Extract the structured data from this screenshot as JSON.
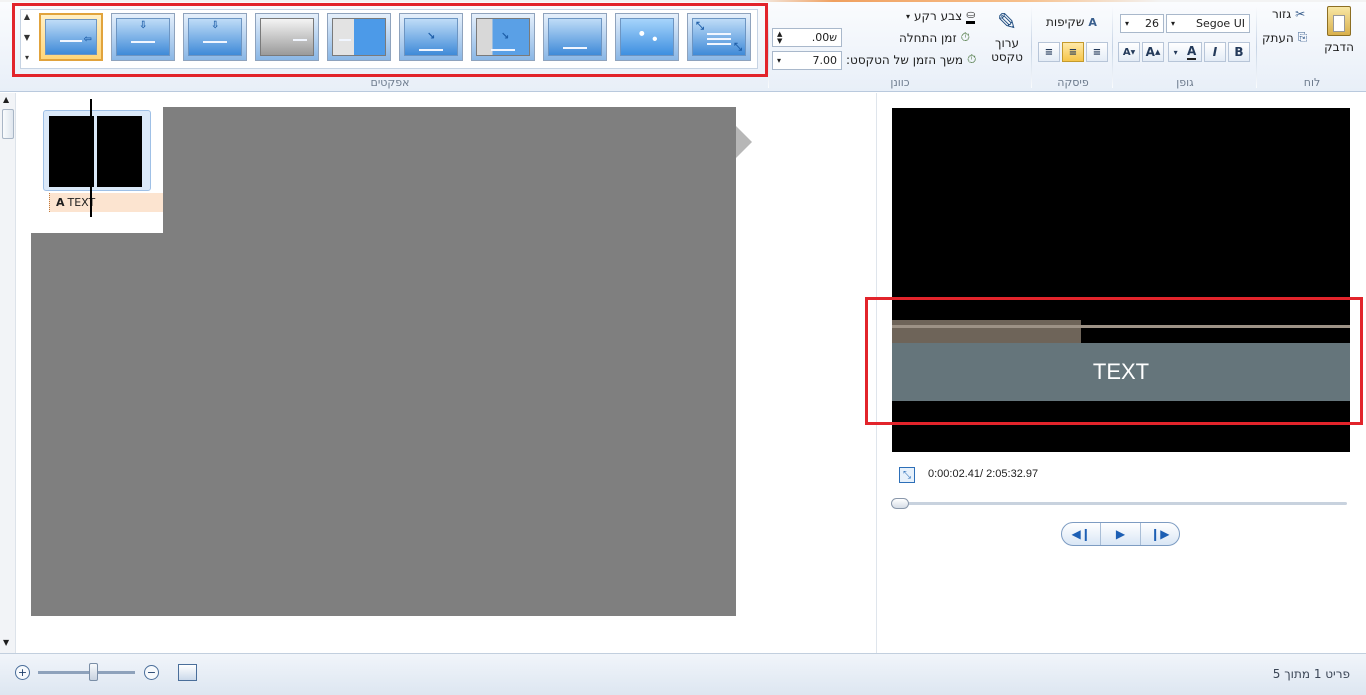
{
  "ribbon": {
    "groups": {
      "clipboard": "לוח",
      "font": "גופן",
      "paragraph": "פיסקה",
      "adjust": "כוונן",
      "effects": "אפקטים"
    },
    "clipboard": {
      "paste": "הדבק",
      "cut": "גזור",
      "copy": "העתק"
    },
    "font": {
      "family": "Segoe UI",
      "size": "26",
      "bold": "B",
      "italic": "I",
      "color": "A",
      "grow": "A",
      "shrink": "A"
    },
    "paragraph": {
      "transparency": "שקיפות"
    },
    "adjust": {
      "edit_text": "ערוך טקסט",
      "background_color": "צבע רקע",
      "start_time": "זמן התחלה",
      "text_duration": "משך הזמן של הטקסט:",
      "start_time_value": ".00ש",
      "duration_value": "7.00"
    },
    "effects_count": 10
  },
  "timeline": {
    "caption_label": "TEXT"
  },
  "preview": {
    "overlay_text": "TEXT",
    "time_current": "0:00:02.41",
    "time_total": "2:05:32.97",
    "time_display": "0:00:02.41/ 2:05:32.97",
    "seek_position": 0.004
  },
  "statusbar": {
    "item_text": "פריט 1 מתוך 5",
    "zoom_level": 0.55
  },
  "colors": {
    "highlight": "#e2242b",
    "caption_bar": "#65757b",
    "selected_effect": "#e1a33c"
  }
}
